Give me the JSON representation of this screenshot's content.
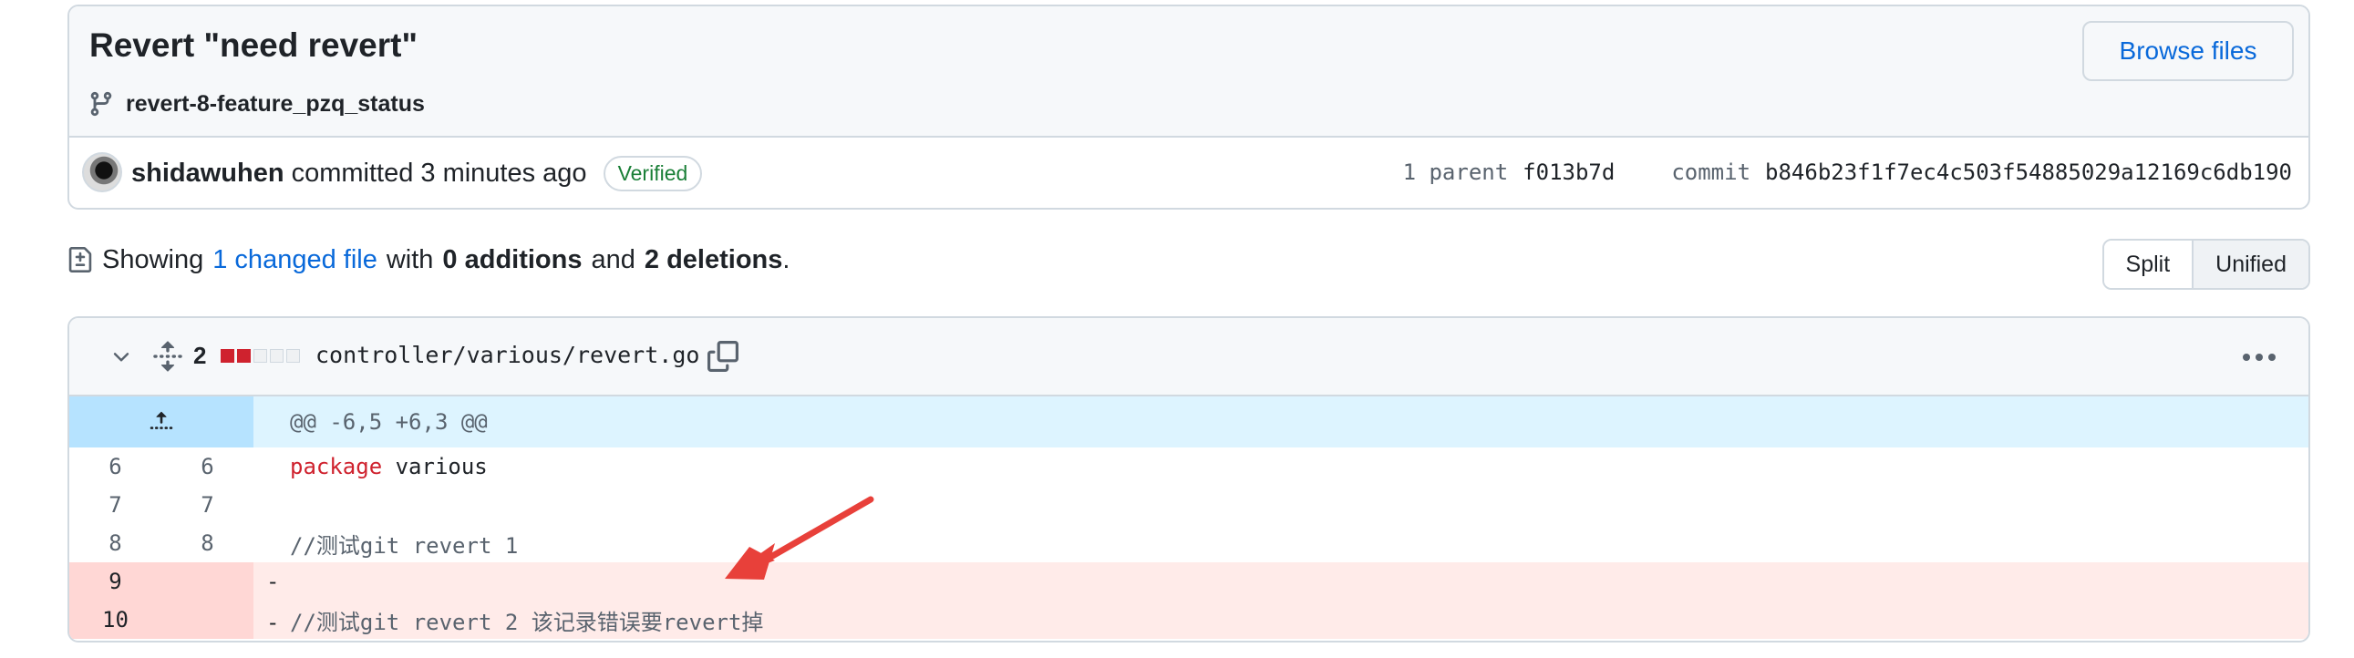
{
  "commit": {
    "title": "Revert \"need revert\"",
    "branch": "revert-8-feature_pzq_status",
    "browse_label": "Browse files",
    "author": "shidawuhen",
    "action": "committed 3 minutes ago",
    "verified": "Verified",
    "parent_label": "1 parent",
    "parent_sha": "f013b7d",
    "commit_label": "commit",
    "commit_sha": "b846b23f1f7ec4c503f54885029a12169c6db190"
  },
  "summary": {
    "showing": "Showing",
    "changed": "1 changed file",
    "with": "with",
    "additions": "0 additions",
    "and": "and",
    "deletions": "2 deletions",
    "period": "."
  },
  "view": {
    "split": "Split",
    "unified": "Unified"
  },
  "file": {
    "change_count": "2",
    "path": "controller/various/revert.go",
    "hunk": "@@ -6,5 +6,3 @@",
    "lines": [
      {
        "old": "6",
        "new": "6",
        "sign": "",
        "keyword": "package",
        "text": " various"
      },
      {
        "old": "7",
        "new": "7",
        "sign": "",
        "keyword": "",
        "text": ""
      },
      {
        "old": "8",
        "new": "8",
        "sign": "",
        "keyword": "",
        "text": "//测试git revert 1"
      },
      {
        "old": "9",
        "new": "",
        "sign": "-",
        "keyword": "",
        "text": ""
      },
      {
        "old": "10",
        "new": "",
        "sign": "-",
        "keyword": "",
        "text": "//测试git revert 2 该记录错误要revert掉"
      }
    ]
  },
  "colors": {
    "accent": "#0969da",
    "verified": "#1a7f37",
    "deletion": "#cf222e",
    "arrow": "#e8403a"
  }
}
